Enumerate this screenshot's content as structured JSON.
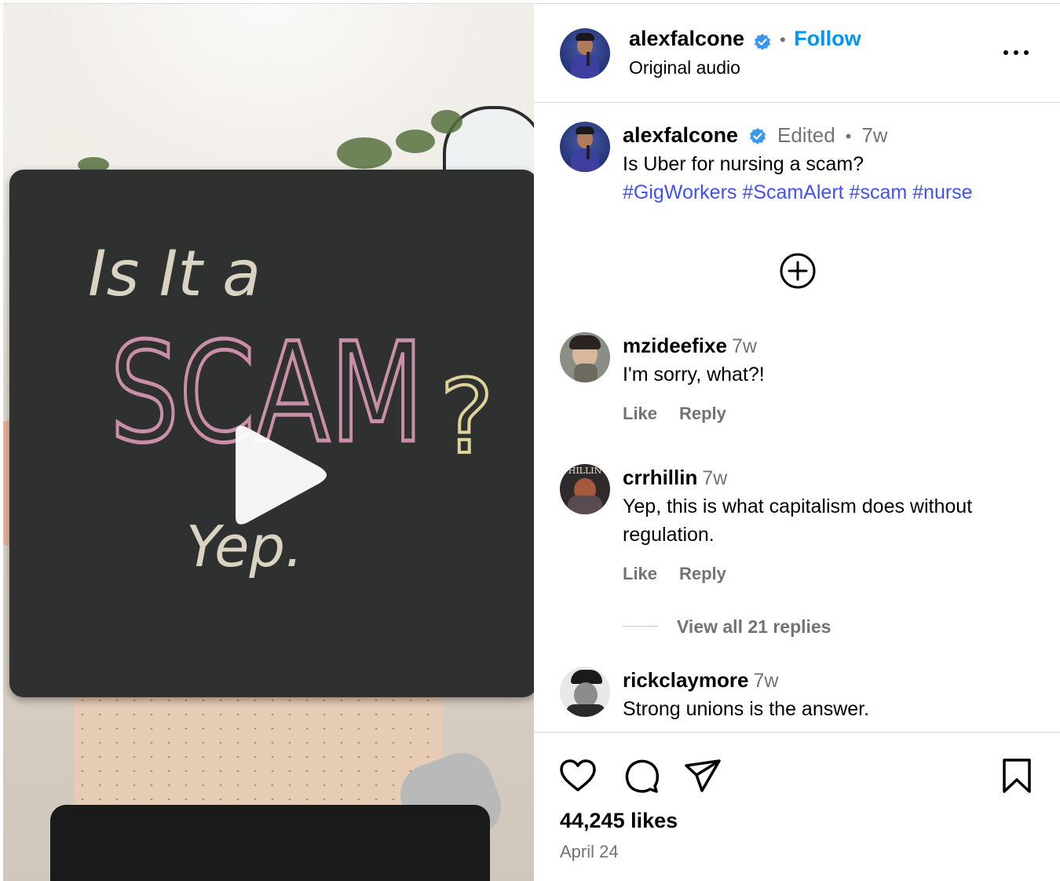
{
  "post": {
    "author": "alexfalcone",
    "audio": "Original audio",
    "follow_label": "Follow",
    "separator": "•",
    "caption": {
      "edited_label": "Edited",
      "time": "7w",
      "text": "Is Uber for nursing a scam?",
      "hashtags": [
        "#GigWorkers",
        "#ScamAlert",
        "#scam",
        "#nurse"
      ]
    },
    "likes": "44,245 likes",
    "date": "April 24"
  },
  "media": {
    "board_line1": "Is It a",
    "board_line2": "SCAM",
    "board_question": "?",
    "board_line3": "Yep."
  },
  "comments": [
    {
      "user": "mzideefixe",
      "time": "7w",
      "lines": [
        "I'm sorry, what?!"
      ],
      "like_label": "Like",
      "reply_label": "Reply"
    },
    {
      "user": "crrhillin",
      "time": "7w",
      "avatar_text": "HILLIN",
      "lines": [
        "Yep, this is what capitalism does without",
        "regulation."
      ],
      "like_label": "Like",
      "reply_label": "Reply",
      "view_replies": "View all 21 replies"
    },
    {
      "user": "rickclaymore",
      "time": "7w",
      "lines": [
        "Strong unions is the answer."
      ]
    }
  ],
  "icons": {
    "verified": "verified-badge-icon",
    "more": "more-options-icon",
    "add_comment": "add-circle-icon",
    "like": "heart-icon",
    "comment": "comment-bubble-icon",
    "share": "paper-plane-icon",
    "save": "bookmark-icon",
    "play": "play-icon"
  },
  "colors": {
    "link_blue": "#0095f6",
    "hashtag_blue": "#4150f7",
    "muted": "#737373",
    "verified_blue": "#3897f0",
    "chalk_pink": "#c98ea8",
    "chalk_white": "#d9d3c2",
    "chalk_yellow": "#ddd39a"
  }
}
